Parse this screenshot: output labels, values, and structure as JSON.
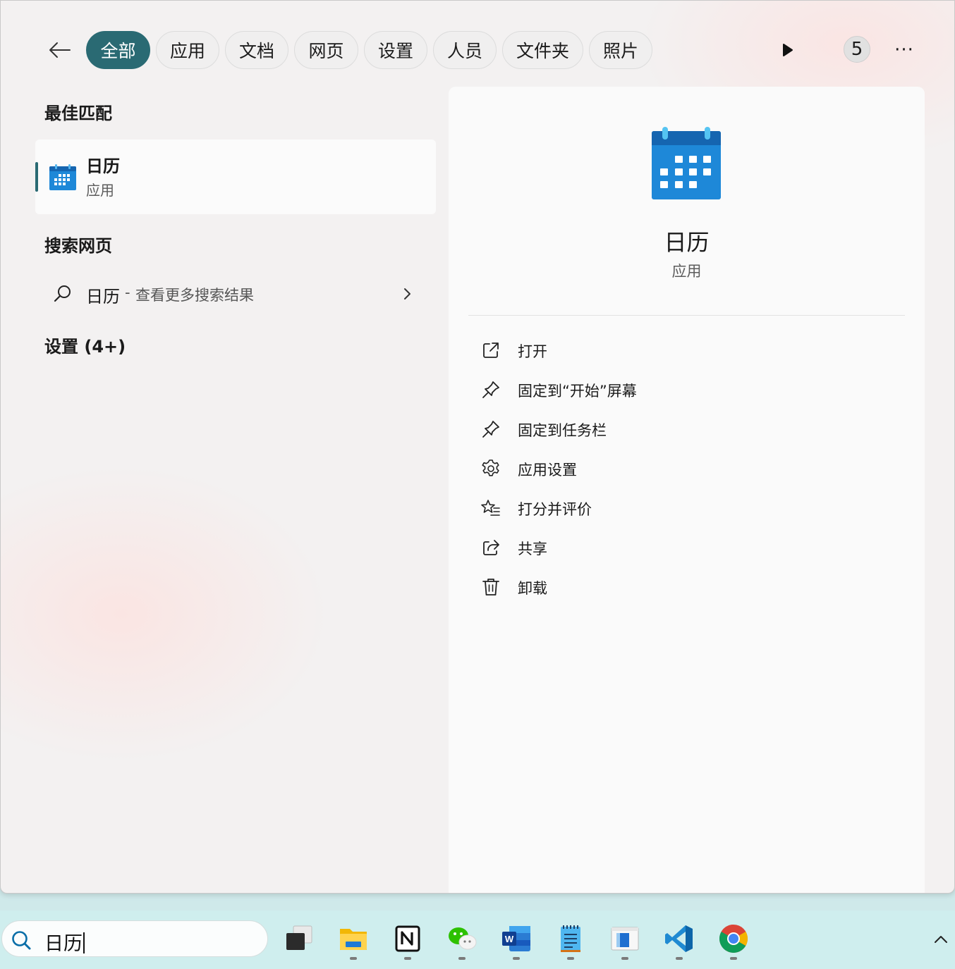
{
  "filters": {
    "tabs": [
      {
        "label": "全部",
        "active": true
      },
      {
        "label": "应用"
      },
      {
        "label": "文档"
      },
      {
        "label": "网页"
      },
      {
        "label": "设置"
      },
      {
        "label": "人员"
      },
      {
        "label": "文件夹"
      },
      {
        "label": "照片"
      }
    ],
    "count": "5",
    "more": "···"
  },
  "best_match": {
    "heading": "最佳匹配",
    "name": "日历",
    "kind": "应用"
  },
  "web": {
    "heading": "搜索网页",
    "query": "日历",
    "separator": "-",
    "hint": "查看更多搜索结果"
  },
  "settings": {
    "heading": "设置 (4+)"
  },
  "detail": {
    "name": "日历",
    "kind": "应用",
    "actions": [
      {
        "label": "打开",
        "icon": "open-external-icon"
      },
      {
        "label": "固定到“开始”屏幕",
        "icon": "pin-icon"
      },
      {
        "label": "固定到任务栏",
        "icon": "pin-icon"
      },
      {
        "label": "应用设置",
        "icon": "gear-icon"
      },
      {
        "label": "打分并评价",
        "icon": "star-list-icon"
      },
      {
        "label": "共享",
        "icon": "share-icon"
      },
      {
        "label": "卸载",
        "icon": "trash-icon"
      }
    ]
  },
  "taskbar": {
    "search_text": "日历",
    "apps": [
      "task-view",
      "file-explorer",
      "notion",
      "wechat",
      "word",
      "notepad",
      "windows-app",
      "vscode",
      "chrome"
    ]
  },
  "colors": {
    "accent": "#2a6a73",
    "calendar_blue": "#1e88d8"
  }
}
